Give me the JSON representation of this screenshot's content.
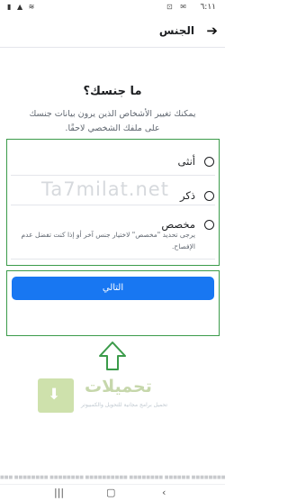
{
  "status_bar": {
    "time": "٦:١١",
    "left_icons": "▮ ▲ ≋",
    "right_icons": "⊡ ✉"
  },
  "header": {
    "title": "الجنس",
    "back_icon": "arrow-right-icon"
  },
  "question": "ما جنسك؟",
  "description": "يمكنك تغيير الأشخاص الذين يرون بيانات جنسك على ملفك الشخصي لاحقًا.",
  "options": [
    {
      "label": "أنثى",
      "selected": false
    },
    {
      "label": "ذكر",
      "selected": false
    },
    {
      "label": "مخصص",
      "selected": false
    }
  ],
  "custom_hint": "يرجى تحديد \"مخصص\" لاختيار جنس آخر أو إذا كنت تفضل عدم الإفصاح.",
  "next_button": "التالي",
  "watermark_text": "Ta7milat.net",
  "logo": {
    "name": "تحميلات",
    "tagline": "تحميل برامج مجانية للتحويل والكمبيوتر"
  },
  "bottom_text": "■■■ ■■■■■■■■ ■■■■■■■■ ■■■■■■■■■■ ■■■■■■■■ ■■■■■■ ■■■■■■■■■■■ ■■■■■■■■■",
  "colors": {
    "accent": "#1877f2",
    "highlight_border": "#3b9b4a"
  }
}
